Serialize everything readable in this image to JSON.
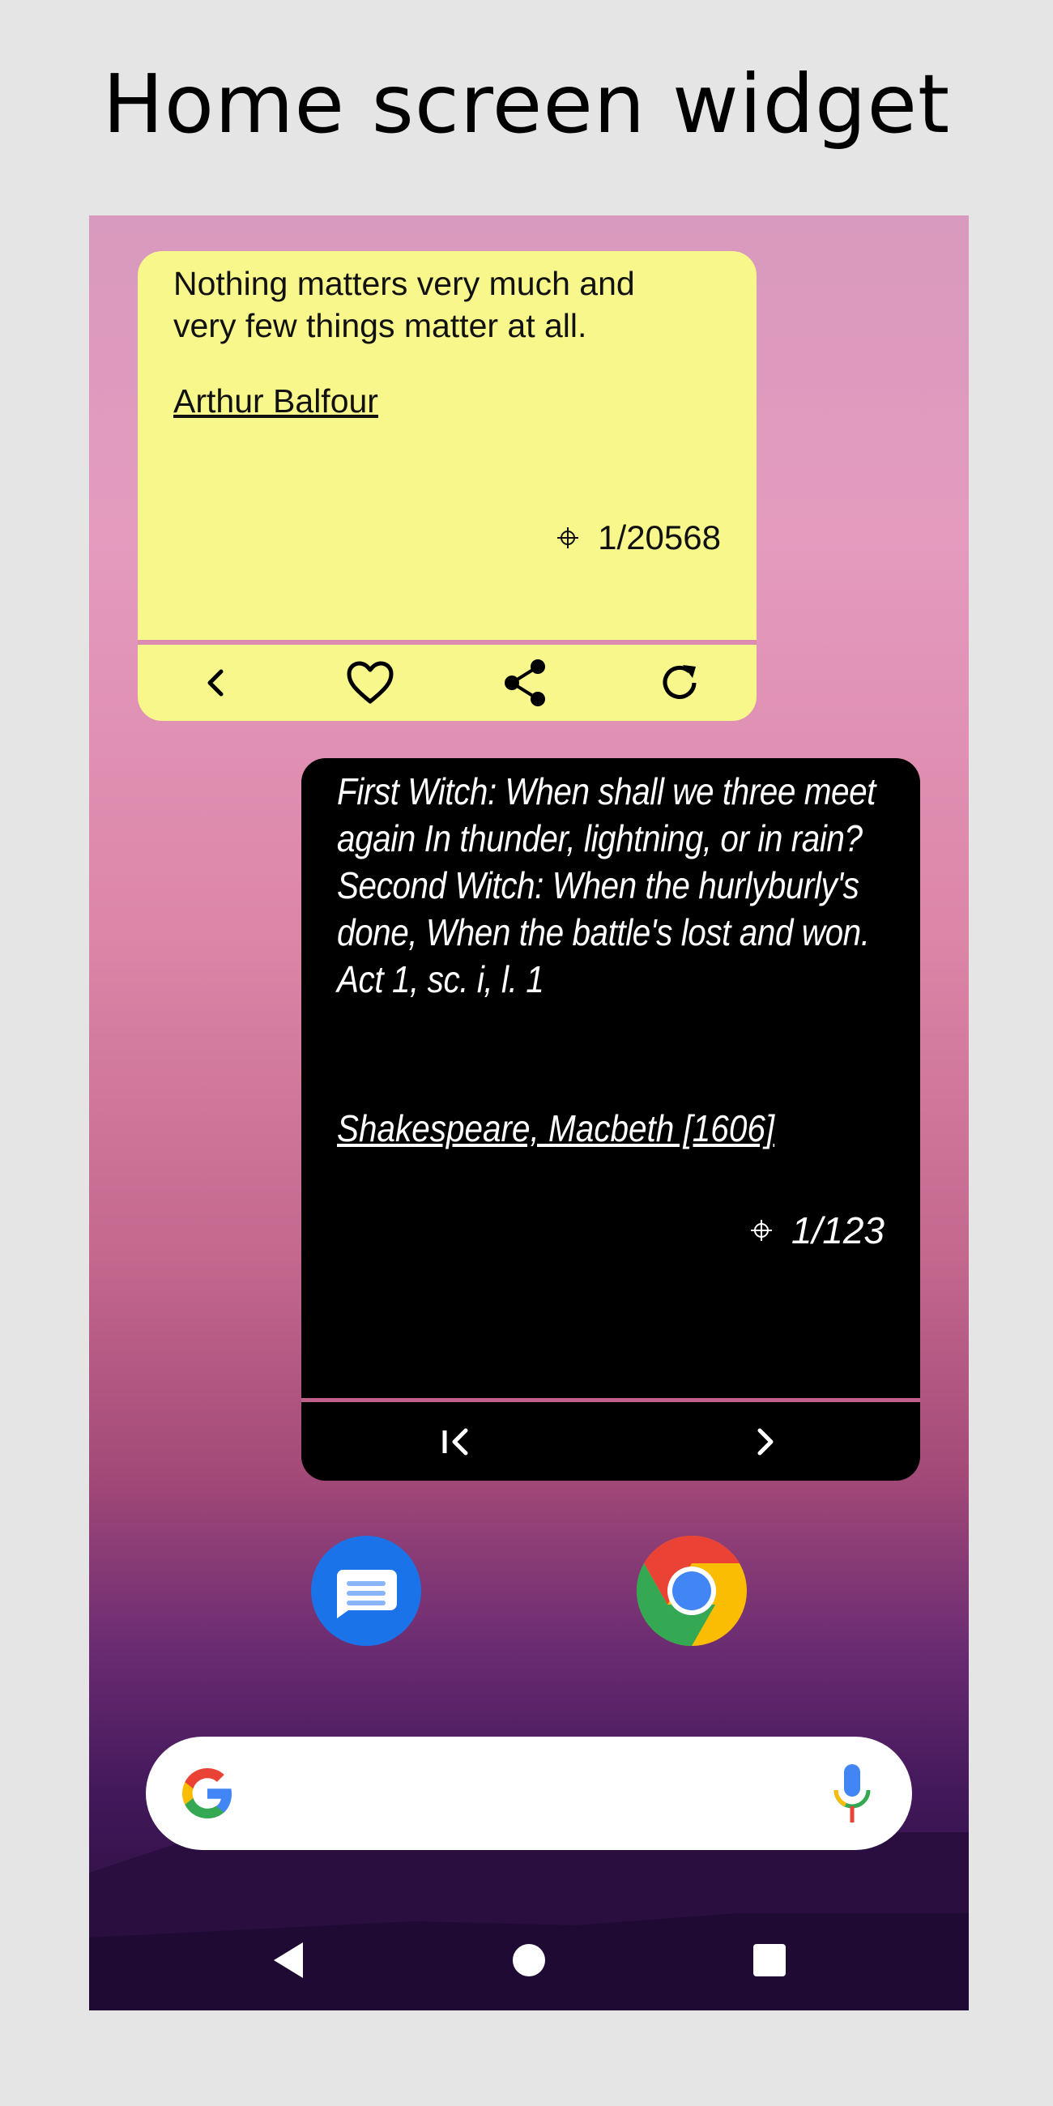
{
  "page": {
    "title": "Home screen widget"
  },
  "widget_light": {
    "quote": "Nothing matters very much and very few things matter at all.",
    "author": "Arthur Balfour",
    "counter": "1/20568",
    "background": "#f7f78c",
    "toolbar": [
      "back-icon",
      "heart-icon",
      "share-icon",
      "refresh-icon"
    ]
  },
  "widget_dark": {
    "quote_line1": "First Witch: When shall we three meet again In thunder, lightning, or in rain?",
    "quote_line2": "Second Witch: When the hurlyburly's done, When the battle's lost and won. Act 1, sc. i, l. 1",
    "author": "Shakespeare, Macbeth [1606]",
    "counter": "1/123",
    "background": "#000000",
    "toolbar": [
      "first-icon",
      "next-icon"
    ]
  },
  "dock": {
    "apps": [
      "messages-app-icon",
      "chrome-app-icon"
    ]
  },
  "search": {
    "icons": [
      "google-g-icon",
      "microphone-icon"
    ]
  },
  "navbar": {
    "buttons": [
      "back-triangle-icon",
      "home-circle-icon",
      "recents-square-icon"
    ]
  }
}
